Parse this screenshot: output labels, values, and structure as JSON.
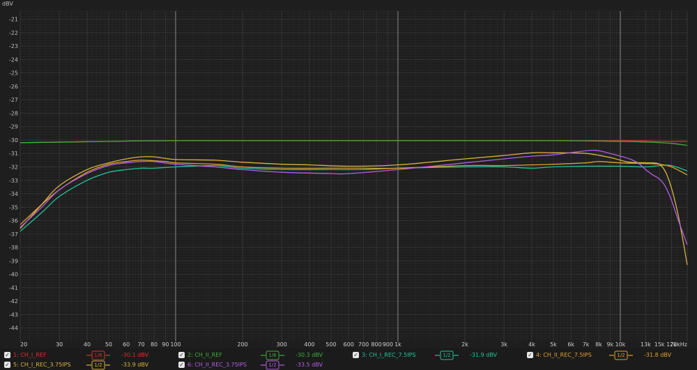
{
  "chart_data": {
    "type": "line",
    "title": "",
    "y_unit": "dBV",
    "x_unit": "Hz",
    "xscale": "log",
    "xlim": [
      20,
      20000
    ],
    "ylim": [
      -45,
      -20.4
    ],
    "grid": true,
    "legend_position": "bottom",
    "y_ticks": [
      -21,
      -22,
      -23,
      -24,
      -25,
      -26,
      -27,
      -28,
      -29,
      -30,
      -31,
      -32,
      -33,
      -34,
      -35,
      -36,
      -37,
      -38,
      -39,
      -40,
      -41,
      -42,
      -43,
      -44
    ],
    "x_ticks": [
      {
        "value": 20,
        "label": "20"
      },
      {
        "value": 30,
        "label": "30"
      },
      {
        "value": 40,
        "label": "40"
      },
      {
        "value": 50,
        "label": "50"
      },
      {
        "value": 60,
        "label": "60"
      },
      {
        "value": 70,
        "label": "70"
      },
      {
        "value": 80,
        "label": "80"
      },
      {
        "value": 90,
        "label": "90"
      },
      {
        "value": 100,
        "label": "100"
      },
      {
        "value": 200,
        "label": "200"
      },
      {
        "value": 300,
        "label": "300"
      },
      {
        "value": 400,
        "label": "400"
      },
      {
        "value": 500,
        "label": "500"
      },
      {
        "value": 600,
        "label": "600"
      },
      {
        "value": 700,
        "label": "700"
      },
      {
        "value": 800,
        "label": "800"
      },
      {
        "value": 900,
        "label": "900"
      },
      {
        "value": 1000,
        "label": "1k"
      },
      {
        "value": 2000,
        "label": "2k"
      },
      {
        "value": 3000,
        "label": "3k"
      },
      {
        "value": 4000,
        "label": "4k"
      },
      {
        "value": 5000,
        "label": "5k"
      },
      {
        "value": 6000,
        "label": "6k"
      },
      {
        "value": 7000,
        "label": "7k"
      },
      {
        "value": 8000,
        "label": "8k"
      },
      {
        "value": 9000,
        "label": "9k"
      },
      {
        "value": 10000,
        "label": "10k"
      },
      {
        "value": 13000,
        "label": "13k"
      },
      {
        "value": 15000,
        "label": "15k"
      },
      {
        "value": 17000,
        "label": "17k"
      },
      {
        "value": 20000,
        "label": "20kHz"
      }
    ],
    "series": [
      {
        "name": "1: CH_I_REF",
        "color": "#e0302a",
        "smoothing": "1/6",
        "level": "-30.1 dBV",
        "points": [
          [
            20,
            -30.2
          ],
          [
            50,
            -30.1
          ],
          [
            100,
            -30.05
          ],
          [
            1000,
            -30.05
          ],
          [
            10000,
            -30.05
          ],
          [
            15000,
            -30.1
          ],
          [
            20000,
            -30.1
          ]
        ]
      },
      {
        "name": "2: CH_II_REF",
        "color": "#3fae3f",
        "smoothing": "1/6",
        "level": "-30.3 dBV",
        "points": [
          [
            20,
            -30.2
          ],
          [
            50,
            -30.1
          ],
          [
            100,
            -30.05
          ],
          [
            1000,
            -30.05
          ],
          [
            5000,
            -30.05
          ],
          [
            10000,
            -30.1
          ],
          [
            13000,
            -30.15
          ],
          [
            17000,
            -30.25
          ],
          [
            20000,
            -30.4
          ]
        ]
      },
      {
        "name": "3: CH_I_REC_7.5IPS",
        "color": "#22c49a",
        "smoothing": "1/2",
        "level": "-31.9 dBV",
        "points": [
          [
            20,
            -36.8
          ],
          [
            25,
            -35.4
          ],
          [
            30,
            -34.2
          ],
          [
            40,
            -33.0
          ],
          [
            50,
            -32.4
          ],
          [
            60,
            -32.2
          ],
          [
            70,
            -32.1
          ],
          [
            80,
            -32.1
          ],
          [
            100,
            -32.0
          ],
          [
            150,
            -31.9
          ],
          [
            200,
            -32.1
          ],
          [
            300,
            -32.2
          ],
          [
            500,
            -32.2
          ],
          [
            700,
            -32.2
          ],
          [
            1000,
            -32.1
          ],
          [
            2000,
            -32.0
          ],
          [
            3000,
            -32.0
          ],
          [
            4000,
            -32.1
          ],
          [
            5000,
            -32.0
          ],
          [
            7000,
            -31.95
          ],
          [
            10000,
            -31.95
          ],
          [
            13000,
            -32.0
          ],
          [
            15000,
            -31.9
          ],
          [
            17000,
            -31.9
          ],
          [
            20000,
            -32.3
          ]
        ]
      },
      {
        "name": "4: CH_II_REC_7.5IPS",
        "color": "#e0a030",
        "smoothing": "1/2",
        "level": "-31.8 dBV",
        "points": [
          [
            20,
            -36.3
          ],
          [
            25,
            -34.8
          ],
          [
            30,
            -33.7
          ],
          [
            40,
            -32.4
          ],
          [
            50,
            -31.8
          ],
          [
            60,
            -31.6
          ],
          [
            70,
            -31.5
          ],
          [
            90,
            -31.6
          ],
          [
            100,
            -31.7
          ],
          [
            150,
            -31.8
          ],
          [
            200,
            -32.0
          ],
          [
            300,
            -32.1
          ],
          [
            500,
            -32.1
          ],
          [
            700,
            -32.1
          ],
          [
            1000,
            -32.1
          ],
          [
            2000,
            -31.9
          ],
          [
            3000,
            -31.9
          ],
          [
            5000,
            -31.8
          ],
          [
            7000,
            -31.7
          ],
          [
            8000,
            -31.6
          ],
          [
            10000,
            -31.7
          ],
          [
            13000,
            -31.75
          ],
          [
            15000,
            -31.8
          ],
          [
            17000,
            -32.0
          ],
          [
            20000,
            -32.6
          ]
        ]
      },
      {
        "name": "5: CH_I_REC_3.75IPS",
        "color": "#d9b341",
        "smoothing": "1/2",
        "level": "-33.9 dBV",
        "points": [
          [
            20,
            -36.6
          ],
          [
            25,
            -34.8
          ],
          [
            30,
            -33.4
          ],
          [
            40,
            -32.2
          ],
          [
            50,
            -31.7
          ],
          [
            60,
            -31.4
          ],
          [
            70,
            -31.25
          ],
          [
            80,
            -31.25
          ],
          [
            100,
            -31.45
          ],
          [
            150,
            -31.5
          ],
          [
            200,
            -31.65
          ],
          [
            300,
            -31.8
          ],
          [
            400,
            -31.85
          ],
          [
            600,
            -31.95
          ],
          [
            1000,
            -31.85
          ],
          [
            2000,
            -31.4
          ],
          [
            3000,
            -31.15
          ],
          [
            4000,
            -30.95
          ],
          [
            5000,
            -30.95
          ],
          [
            7000,
            -31.0
          ],
          [
            9000,
            -31.3
          ],
          [
            10000,
            -31.5
          ],
          [
            11000,
            -31.65
          ],
          [
            13000,
            -31.7
          ],
          [
            14000,
            -31.7
          ],
          [
            15000,
            -31.8
          ],
          [
            16000,
            -32.4
          ],
          [
            17000,
            -33.6
          ],
          [
            18000,
            -35.2
          ],
          [
            19000,
            -37.2
          ],
          [
            20000,
            -39.3
          ]
        ]
      },
      {
        "name": "6: CH_II_REC_3.75IPS",
        "color": "#b65ee6",
        "smoothing": "1/2",
        "level": "-33.5 dBV",
        "points": [
          [
            20,
            -36.5
          ],
          [
            25,
            -35.0
          ],
          [
            30,
            -33.7
          ],
          [
            40,
            -32.5
          ],
          [
            50,
            -31.9
          ],
          [
            60,
            -31.7
          ],
          [
            70,
            -31.6
          ],
          [
            80,
            -31.6
          ],
          [
            100,
            -31.8
          ],
          [
            150,
            -32.0
          ],
          [
            200,
            -32.2
          ],
          [
            300,
            -32.4
          ],
          [
            500,
            -32.5
          ],
          [
            600,
            -32.5
          ],
          [
            1000,
            -32.2
          ],
          [
            2000,
            -31.7
          ],
          [
            3000,
            -31.4
          ],
          [
            4000,
            -31.2
          ],
          [
            5000,
            -31.1
          ],
          [
            7000,
            -30.8
          ],
          [
            8000,
            -30.8
          ],
          [
            10000,
            -31.2
          ],
          [
            11000,
            -31.4
          ],
          [
            12000,
            -31.7
          ],
          [
            13000,
            -32.2
          ],
          [
            14000,
            -32.6
          ],
          [
            15000,
            -32.9
          ],
          [
            16000,
            -33.5
          ],
          [
            17000,
            -34.5
          ],
          [
            18000,
            -35.7
          ],
          [
            19000,
            -36.8
          ],
          [
            20000,
            -37.8
          ]
        ]
      }
    ]
  }
}
